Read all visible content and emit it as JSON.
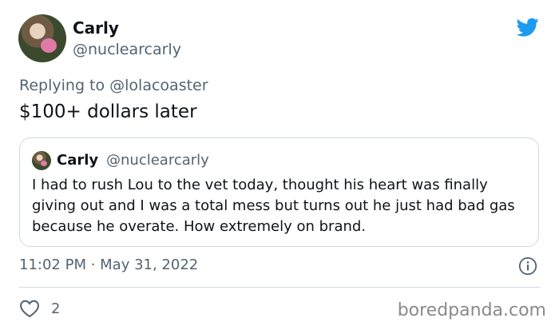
{
  "tweet": {
    "display_name": "Carly",
    "handle": "@nuclearcarly",
    "replying_prefix": "Replying to ",
    "replying_to": "@lolacoaster",
    "text": "$100+ dollars later",
    "timestamp": "11:02 PM · May 31, 2022",
    "like_count": "2"
  },
  "quoted": {
    "display_name": "Carly",
    "handle": "@nuclearcarly",
    "text": "I had to rush Lou to the vet today, thought his heart was finally giving out and I was a total mess but turns out he just had bad gas because he overate. How extremely on brand."
  },
  "watermark": "boredpanda.com",
  "icons": {
    "logo": "twitter-bird-icon",
    "info": "info-icon",
    "like": "heart-icon"
  },
  "colors": {
    "brand": "#1d9bf0",
    "secondary_text": "#536471",
    "border": "#cfd9de"
  }
}
